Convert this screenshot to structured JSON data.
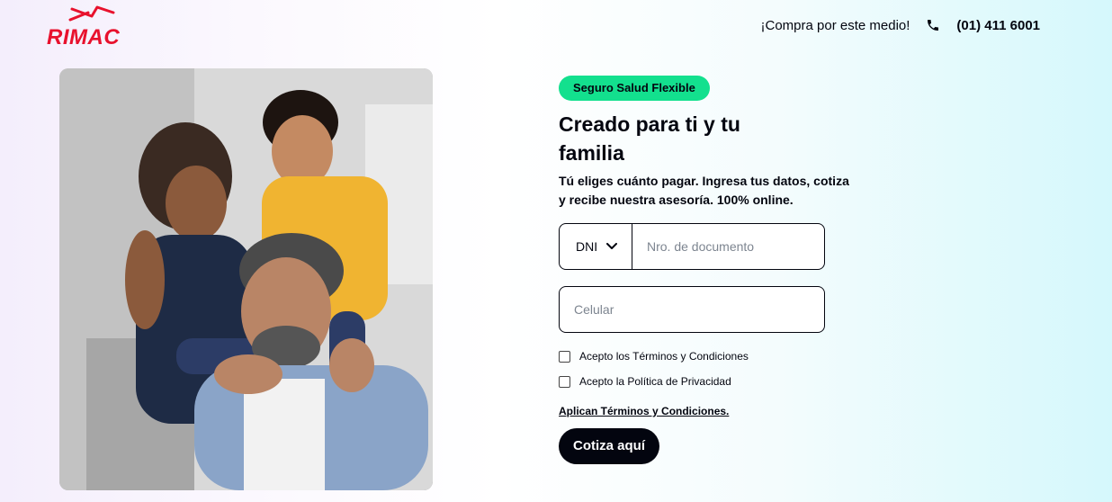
{
  "brand": {
    "name": "RIMAC",
    "color": "#e8112d",
    "icon": "rimac-logo"
  },
  "header": {
    "buy_text": "¡Compra por este medio!",
    "phone_icon": "phone-icon",
    "phone_number": "(01) 411 6001"
  },
  "hero": {
    "image_subject": "family-photo"
  },
  "form": {
    "badge": "Seguro Salud Flexible",
    "badge_color": "#13e08e",
    "title": "Creado para ti y tu familia",
    "subtitle": "Tú eliges cuánto pagar. Ingresa tus datos, cotiza y recibe nuestra asesoría. 100% online.",
    "doc_type": {
      "selected": "DNI",
      "icon": "chevron-down-icon"
    },
    "doc_number": {
      "value": "",
      "placeholder": "Nro. de documento"
    },
    "phone": {
      "value": "",
      "placeholder": "Celular"
    },
    "checkboxes": [
      {
        "label": "Acepto los Términos y Condiciones",
        "checked": false
      },
      {
        "label": "Acepto la Política de Privacidad",
        "checked": false
      }
    ],
    "terms_link": "Aplican Términos y Condiciones.",
    "submit": "Cotiza aquí",
    "submit_color": "#03050f"
  }
}
